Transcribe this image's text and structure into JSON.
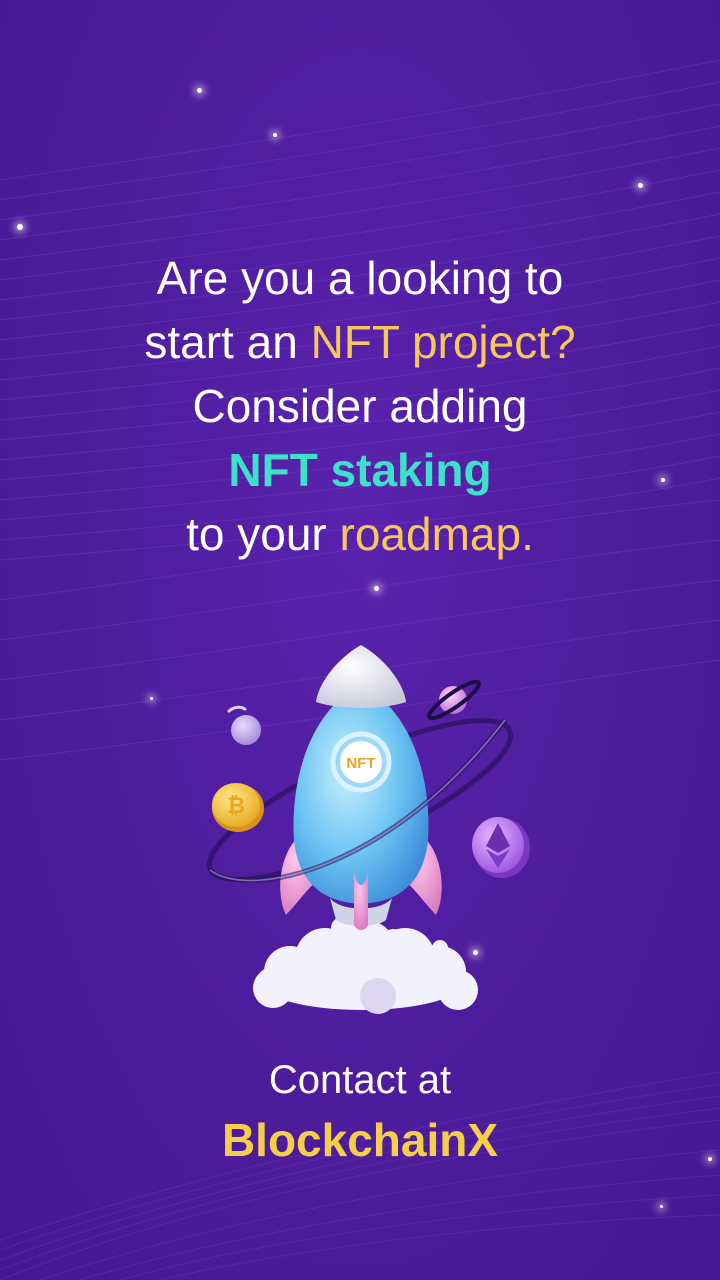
{
  "headline": {
    "line1": "Are you a looking to",
    "line2_prefix": "start an ",
    "line2_highlight": "NFT project?",
    "line3": "Consider adding",
    "line4_highlight": "NFT staking",
    "line5_prefix": "to your ",
    "line5_highlight": "roadmap."
  },
  "illustration": {
    "rocket_badge": "NFT",
    "icons": [
      "rocket-icon",
      "bitcoin-coin-icon",
      "ethereum-coin-icon",
      "planet-icon",
      "orbit-ring-icon",
      "smoke-cloud-icon"
    ]
  },
  "cta": {
    "line": "Contact at",
    "brand": "BlockchainX"
  },
  "colors": {
    "background": "#4f1d9e",
    "accent_yellow": "#f6c85a",
    "accent_teal": "#3de0c9",
    "brand_yellow": "#f6cf4a",
    "text": "#ffffff"
  }
}
